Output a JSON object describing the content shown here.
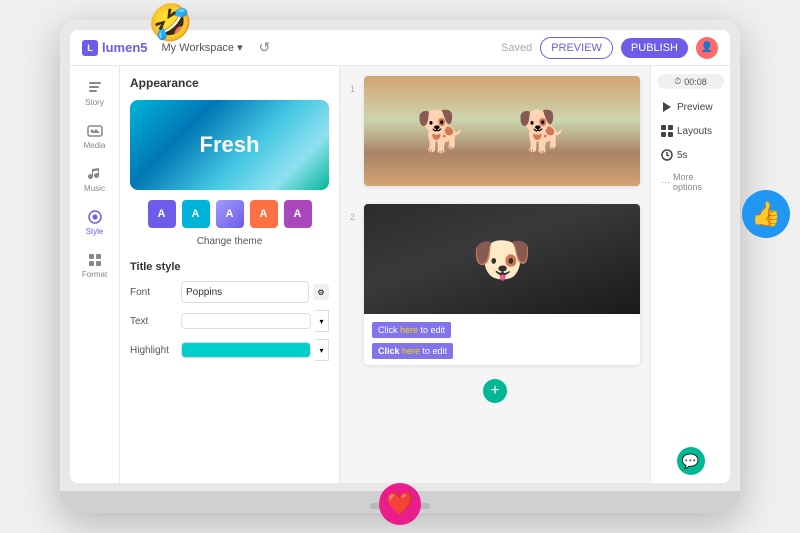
{
  "emoji": {
    "laugh": "🤣",
    "thumbsup": "👍",
    "heart": "❤️"
  },
  "header": {
    "logo": "lumen5",
    "workspace": "My Workspace",
    "undo_icon": "↺",
    "saved_label": "Saved",
    "preview_label": "PREVIEW",
    "publish_label": "PUBLISH"
  },
  "sidebar": {
    "items": [
      {
        "label": "Story",
        "icon": "story"
      },
      {
        "label": "Media",
        "icon": "media"
      },
      {
        "label": "Music",
        "icon": "music"
      },
      {
        "label": "Style",
        "icon": "style"
      },
      {
        "label": "Format",
        "icon": "format"
      }
    ]
  },
  "panel": {
    "appearance_title": "Appearance",
    "theme_text": "Fresh",
    "swatches": [
      {
        "color": "#6c5ce7",
        "label": "A"
      },
      {
        "color": "#00b4d8",
        "label": "A"
      },
      {
        "color": "#a29bfe",
        "label": "A"
      },
      {
        "color": "#fd7043",
        "label": "A"
      },
      {
        "color": "#ab47bc",
        "label": "A"
      }
    ],
    "change_theme_label": "Change theme",
    "title_style_label": "Title style",
    "font_label": "Font",
    "font_value": "Poppins",
    "text_label": "Text",
    "highlight_label": "Highlight"
  },
  "canvas": {
    "slide1_num": "1",
    "slide2_num": "2",
    "edit_text_1": "Click here to edit",
    "edit_text_2": "Click here to edit",
    "add_slide_icon": "+"
  },
  "right_panel": {
    "timer": "00:08",
    "preview_label": "Preview",
    "layouts_label": "Layouts",
    "duration_label": "5s",
    "more_options_label": "More options"
  }
}
